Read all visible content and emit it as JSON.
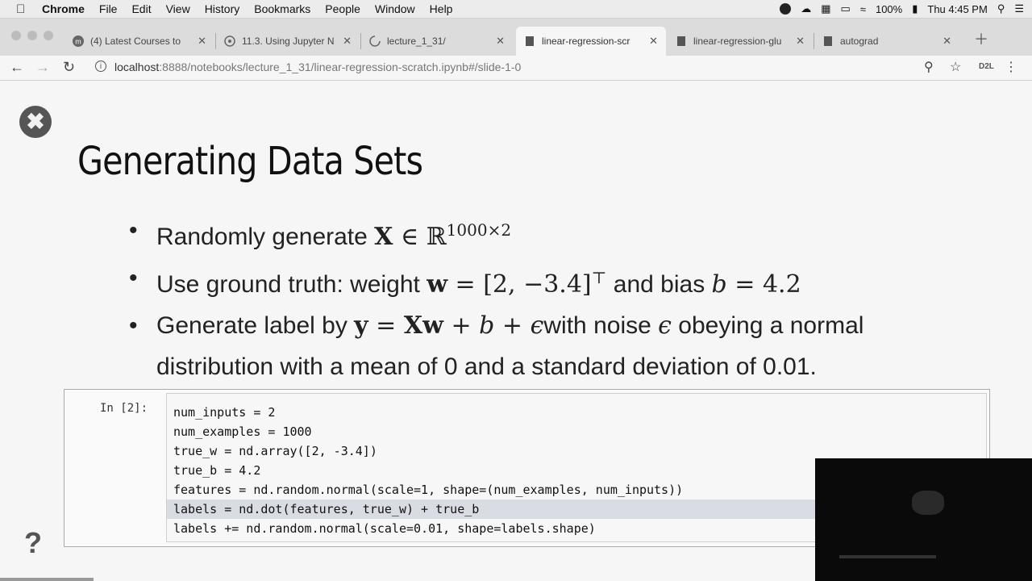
{
  "menubar": {
    "app": "Chrome",
    "items": [
      "File",
      "Edit",
      "View",
      "History",
      "Bookmarks",
      "People",
      "Window",
      "Help"
    ],
    "battery": "100%",
    "clock": "Thu 4:45 PM"
  },
  "tabs": [
    {
      "label": "(4) Latest Courses to",
      "icon": "m-icon"
    },
    {
      "label": "11.3. Using Jupyter N",
      "icon": "globe-icon"
    },
    {
      "label": "lecture_1_31/",
      "icon": "loading-icon"
    },
    {
      "label": "linear-regression-scr",
      "icon": "doc-icon",
      "active": true
    },
    {
      "label": "linear-regression-glu",
      "icon": "doc-icon"
    },
    {
      "label": "autograd",
      "icon": "doc-icon"
    }
  ],
  "toolbar": {
    "url_host": "localhost",
    "url_rest": ":8888/notebooks/lecture_1_31/linear-regression-scratch.ipynb#/slide-1-0",
    "extension": "D2L"
  },
  "slide": {
    "title": "Generating Data Sets",
    "b1_text": "Randomly generate ",
    "b1_X": "X",
    "b1_in": " ∈ ℝ",
    "b1_sup": "1000×2",
    "b2_text": "Use ground truth: weight ",
    "b2_w": "w",
    "b2_eq": " = [2, −3.4]",
    "b2_T": "⊤",
    "b2_mid": " and bias ",
    "b2_b": "b",
    "b2_val": " = 4.2",
    "b3_text": "Generate label by ",
    "b3_y": "y",
    "b3_eq": " = ",
    "b3_Xw": "Xw",
    "b3_plus": " + ",
    "b3_b": "b",
    "b3_plus2": " + ",
    "b3_eps": "ϵ",
    "b3_rest1": "with noise ",
    "b3_eps2": "ϵ",
    "b3_rest2": " obeying a normal distribution with a mean of 0 and a standard deviation of 0.01."
  },
  "cell": {
    "prompt": "In [2]:",
    "lines": [
      "num_inputs = 2",
      "num_examples = 1000",
      "true_w = nd.array([2, -3.4])",
      "true_b = 4.2",
      "features = nd.random.normal(scale=1, shape=(num_examples, num_inputs))",
      "labels = nd.dot(features, true_w) + true_b",
      "labels += nd.random.normal(scale=0.01, shape=labels.shape)"
    ]
  }
}
